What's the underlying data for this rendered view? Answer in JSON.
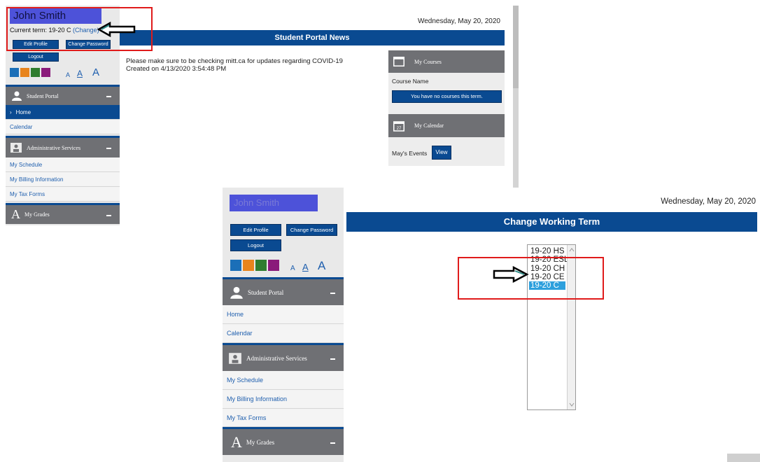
{
  "user": {
    "name": "John Smith"
  },
  "current_term": {
    "label": "Current term: 19-20 C",
    "change_link": "(Change)"
  },
  "buttons": {
    "edit_profile": "Edit Profile",
    "change_password": "Change Password",
    "logout": "Logout"
  },
  "theme_swatches": [
    "#1b6fb8",
    "#e8841c",
    "#2f7d2f",
    "#8a1a7a"
  ],
  "font_sizes": [
    "A",
    "A",
    "A"
  ],
  "sections": {
    "student_portal": {
      "label": "Student Portal",
      "items": [
        "Home",
        "Calendar"
      ]
    },
    "admin_services": {
      "label": "Administrative Services",
      "items": [
        "My Schedule",
        "My Billing Information",
        "My Tax Forms"
      ]
    },
    "my_grades": {
      "label": "My Grades"
    }
  },
  "date": "Wednesday, May 20, 2020",
  "news": {
    "title": "Student Portal News",
    "message": "Please make sure to be checking mitt.ca for updates regarding COVID-19",
    "created": "Created on 4/13/2020 3:54:48 PM"
  },
  "courses": {
    "title": "My Courses",
    "column": "Course Name",
    "empty_message": "You have no courses this term."
  },
  "calendar": {
    "title": "My Calendar",
    "events_label": "May's Events",
    "view_button": "View",
    "icon_day": "27"
  },
  "change_term": {
    "title": "Change Working Term",
    "options": [
      "19-20 HS",
      "19-20 ESL",
      "19-20 CH",
      "19-20 CE",
      "19-20 C"
    ],
    "selected": "19-20 C"
  },
  "colors": {
    "portal_blue": "#0a4a91",
    "section_gray": "#6f7074",
    "highlight_red": "#e01b1b",
    "name_highlight": "#4d52d9"
  },
  "icons": [
    "person-icon",
    "building-icon",
    "grades-icon",
    "calendar-icon",
    "window-icon",
    "arrow-icon",
    "chevron-right-icon"
  ]
}
